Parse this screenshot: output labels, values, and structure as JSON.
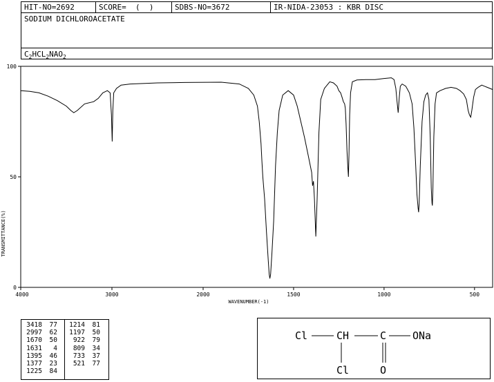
{
  "header": {
    "hit_no": "HIT-NO=2692",
    "score": "SCORE=  (  )",
    "sdbs_no": "SDBS-NO=3672",
    "ir": "IR-NIDA-23053 : KBR DISC",
    "compound_name": "SODIUM DICHLOROACETATE",
    "formula_parts": [
      "C",
      "2",
      "HCL",
      "2",
      "NAO",
      "2"
    ]
  },
  "chart_data": {
    "type": "line",
    "xlabel": "WAVENUMBER(-1)",
    "ylabel": "TRANSMITTANCE(%)",
    "xlim": [
      4000,
      400
    ],
    "ylim": [
      0,
      100
    ],
    "x_ticks": [
      4000,
      3000,
      2000,
      1500,
      1000,
      500
    ],
    "y_ticks": [
      0,
      50,
      100
    ],
    "grid": false,
    "series": [
      {
        "points": [
          [
            4000,
            89
          ],
          [
            3900,
            88.7
          ],
          [
            3800,
            88
          ],
          [
            3700,
            86.5
          ],
          [
            3600,
            84.5
          ],
          [
            3500,
            82
          ],
          [
            3450,
            80
          ],
          [
            3418,
            79
          ],
          [
            3380,
            80
          ],
          [
            3300,
            83
          ],
          [
            3200,
            84
          ],
          [
            3150,
            85.5
          ],
          [
            3100,
            88
          ],
          [
            3050,
            89
          ],
          [
            3020,
            88
          ],
          [
            3005,
            78
          ],
          [
            2997,
            66
          ],
          [
            2990,
            80
          ],
          [
            2980,
            88
          ],
          [
            2950,
            90
          ],
          [
            2900,
            91.5
          ],
          [
            2800,
            92
          ],
          [
            2500,
            92.5
          ],
          [
            2200,
            92.7
          ],
          [
            1900,
            92.8
          ],
          [
            1800,
            92
          ],
          [
            1750,
            90
          ],
          [
            1720,
            87
          ],
          [
            1700,
            82
          ],
          [
            1690,
            75
          ],
          [
            1680,
            65
          ],
          [
            1675,
            57
          ],
          [
            1670,
            50
          ],
          [
            1660,
            40
          ],
          [
            1650,
            25
          ],
          [
            1640,
            12
          ],
          [
            1635,
            6
          ],
          [
            1631,
            4
          ],
          [
            1627,
            6
          ],
          [
            1620,
            15
          ],
          [
            1610,
            30
          ],
          [
            1600,
            55
          ],
          [
            1590,
            70
          ],
          [
            1580,
            80
          ],
          [
            1560,
            87
          ],
          [
            1530,
            89
          ],
          [
            1500,
            87
          ],
          [
            1480,
            82
          ],
          [
            1460,
            75
          ],
          [
            1440,
            68
          ],
          [
            1420,
            60
          ],
          [
            1400,
            52
          ],
          [
            1395,
            46
          ],
          [
            1390,
            48
          ],
          [
            1385,
            40
          ],
          [
            1377,
            23
          ],
          [
            1370,
            40
          ],
          [
            1360,
            70
          ],
          [
            1350,
            85
          ],
          [
            1330,
            90
          ],
          [
            1300,
            93
          ],
          [
            1280,
            92.5
          ],
          [
            1260,
            91
          ],
          [
            1250,
            89
          ],
          [
            1240,
            88
          ],
          [
            1232,
            86
          ],
          [
            1225,
            84
          ],
          [
            1218,
            83
          ],
          [
            1214,
            81
          ],
          [
            1210,
            74
          ],
          [
            1205,
            62
          ],
          [
            1200,
            54
          ],
          [
            1197,
            50
          ],
          [
            1194,
            60
          ],
          [
            1190,
            78
          ],
          [
            1185,
            88
          ],
          [
            1175,
            93
          ],
          [
            1150,
            93.8
          ],
          [
            1100,
            94
          ],
          [
            1050,
            94
          ],
          [
            1000,
            94.5
          ],
          [
            960,
            94.8
          ],
          [
            945,
            94
          ],
          [
            935,
            90
          ],
          [
            928,
            84
          ],
          [
            922,
            79
          ],
          [
            916,
            86
          ],
          [
            910,
            91
          ],
          [
            900,
            92
          ],
          [
            880,
            91
          ],
          [
            860,
            88
          ],
          [
            845,
            83
          ],
          [
            835,
            72
          ],
          [
            825,
            55
          ],
          [
            818,
            42
          ],
          [
            812,
            36
          ],
          [
            809,
            34
          ],
          [
            806,
            38
          ],
          [
            800,
            55
          ],
          [
            790,
            75
          ],
          [
            780,
            84
          ],
          [
            770,
            87
          ],
          [
            760,
            88
          ],
          [
            752,
            85
          ],
          [
            745,
            68
          ],
          [
            739,
            45
          ],
          [
            735,
            38
          ],
          [
            733,
            37
          ],
          [
            730,
            45
          ],
          [
            725,
            68
          ],
          [
            718,
            83
          ],
          [
            710,
            88
          ],
          [
            690,
            89
          ],
          [
            660,
            90
          ],
          [
            630,
            90.5
          ],
          [
            600,
            90
          ],
          [
            580,
            89
          ],
          [
            560,
            87.5
          ],
          [
            545,
            85
          ],
          [
            535,
            80
          ],
          [
            528,
            78
          ],
          [
            521,
            77
          ],
          [
            515,
            80
          ],
          [
            505,
            86
          ],
          [
            495,
            89.5
          ],
          [
            480,
            90.5
          ],
          [
            460,
            91.5
          ],
          [
            445,
            91
          ],
          [
            430,
            90.5
          ],
          [
            415,
            90
          ],
          [
            400,
            89.5
          ]
        ]
      }
    ]
  },
  "peak_table": {
    "left": [
      [
        "3418",
        "77"
      ],
      [
        "2997",
        "62"
      ],
      [
        "1670",
        "50"
      ],
      [
        "1631",
        "4"
      ],
      [
        "1395",
        "46"
      ],
      [
        "1377",
        "23"
      ],
      [
        "1225",
        "84"
      ]
    ],
    "right": [
      [
        "1214",
        "81"
      ],
      [
        "1197",
        "50"
      ],
      [
        "922",
        "79"
      ],
      [
        "809",
        "34"
      ],
      [
        "733",
        "37"
      ],
      [
        "521",
        "77"
      ]
    ]
  },
  "structure": {
    "cl_top": "Cl",
    "ch": "CH",
    "c": "C",
    "ona": "ONa",
    "cl_bottom": "Cl",
    "o": "O"
  }
}
